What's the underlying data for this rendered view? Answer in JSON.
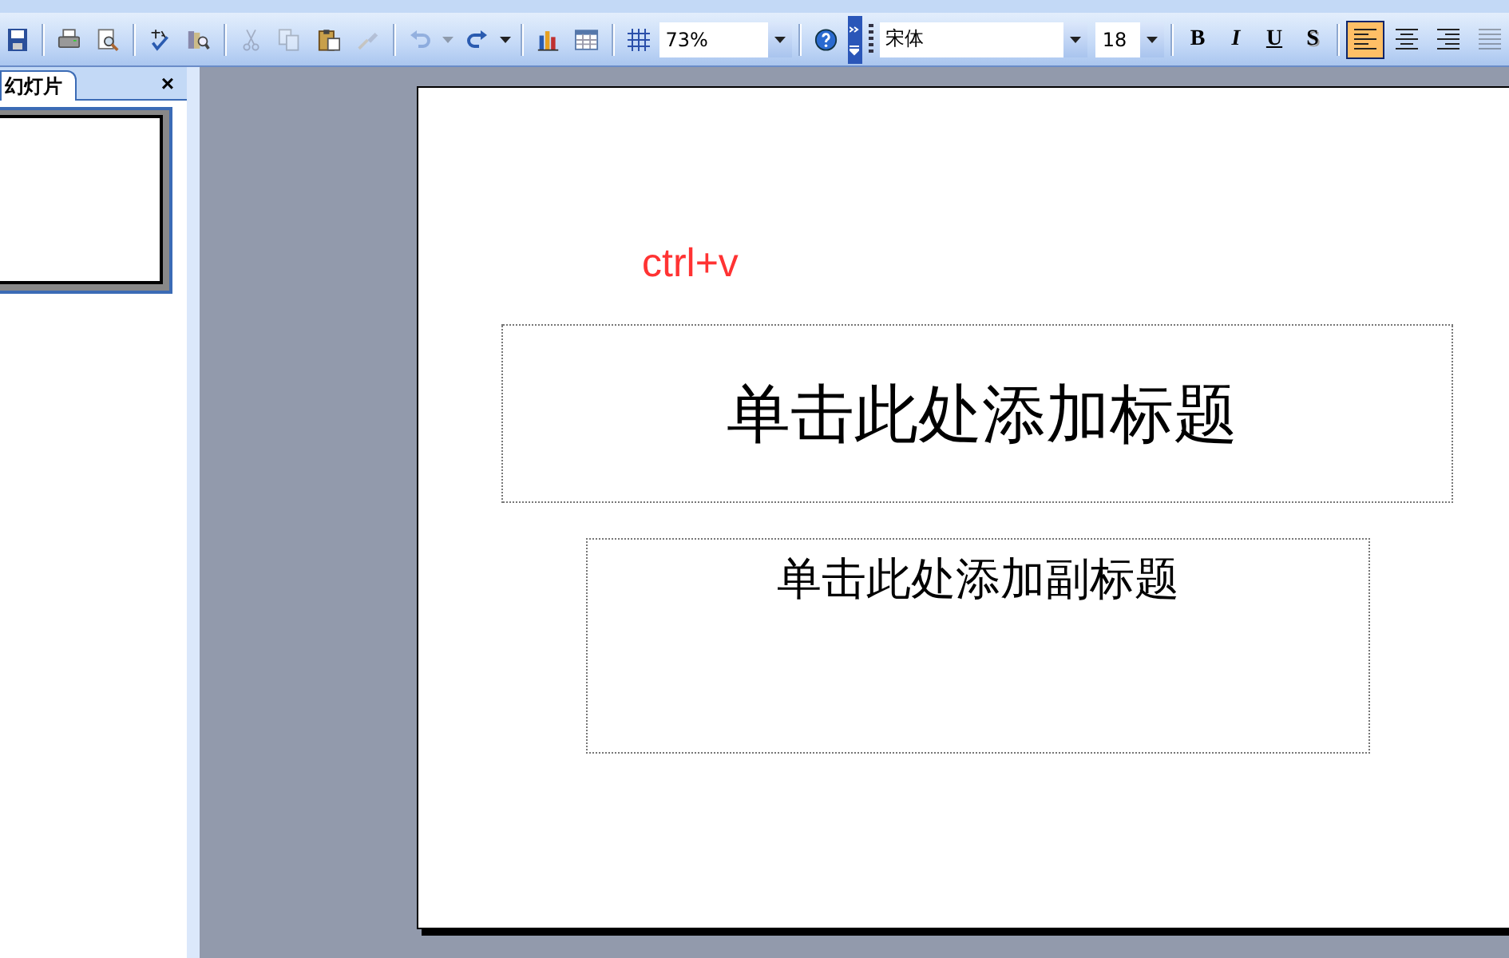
{
  "toolbar": {
    "file_buttons": [
      {
        "disabled": false
      },
      {
        "disabled": false
      },
      {
        "disabled": false
      }
    ],
    "tool_buttons": [
      {
        "disabled": false
      },
      {
        "disabled": false
      }
    ],
    "edit_buttons": [
      {
        "disabled": true
      },
      {
        "disabled": true
      },
      {
        "disabled": false
      },
      {
        "disabled": true
      }
    ],
    "history_buttons": [
      {
        "disabled": true
      },
      {
        "disabled": false
      }
    ],
    "zoom": {
      "value": "73%"
    },
    "font": {
      "value": "宋体"
    },
    "size": {
      "value": "18"
    },
    "format_buttons": [
      {
        "label": "B"
      },
      {
        "label": "I"
      },
      {
        "label": "U"
      },
      {
        "label": "S"
      }
    ],
    "align_buttons": [
      {
        "selected": true,
        "disabled": false
      },
      {
        "selected": false,
        "disabled": false
      },
      {
        "selected": false,
        "disabled": false
      },
      {
        "selected": false,
        "disabled": true
      }
    ]
  },
  "slides_panel": {
    "tab": "幻灯片",
    "close": "×",
    "thumbnails": [
      {
        "selected": true
      }
    ]
  },
  "slide": {
    "pasted_text": "ctrl+v",
    "title_placeholder": "单击此处添加标题",
    "subtitle_placeholder": "单击此处添加副标题"
  }
}
